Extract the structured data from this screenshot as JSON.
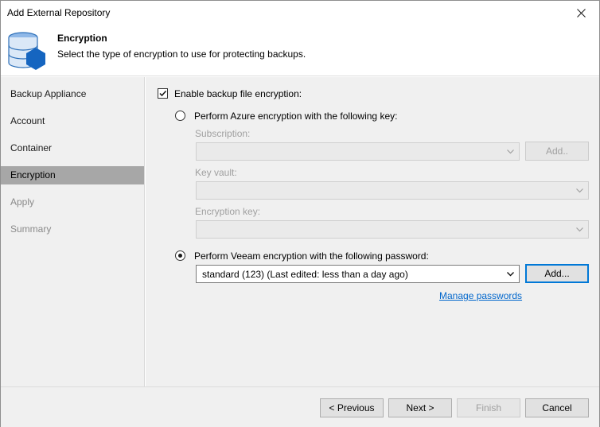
{
  "window": {
    "title": "Add External Repository"
  },
  "header": {
    "title": "Encryption",
    "subtitle": "Select the type of encryption to use for protecting backups.",
    "icon": "database-hexagon-icon"
  },
  "sidebar": {
    "items": [
      {
        "label": "Backup Appliance",
        "state": "normal"
      },
      {
        "label": "Account",
        "state": "normal"
      },
      {
        "label": "Container",
        "state": "normal"
      },
      {
        "label": "Encryption",
        "state": "active"
      },
      {
        "label": "Apply",
        "state": "disabled"
      },
      {
        "label": "Summary",
        "state": "disabled"
      }
    ]
  },
  "form": {
    "enable_label": "Enable backup file encryption:",
    "enable_checked": true,
    "azure": {
      "label": "Perform Azure encryption with the following key:",
      "selected": false,
      "subscription_label": "Subscription:",
      "subscription_value": "",
      "add_label": "Add..",
      "keyvault_label": "Key vault:",
      "keyvault_value": "",
      "enckey_label": "Encryption key:",
      "enckey_value": ""
    },
    "veeam": {
      "label": "Perform Veeam encryption with the following password:",
      "selected": true,
      "password_value": "standard (123) (Last edited: less than a day ago)",
      "add_label": "Add...",
      "manage_link": "Manage passwords"
    }
  },
  "footer": {
    "previous_label": "< Previous",
    "next_label": "Next >",
    "finish_label": "Finish",
    "cancel_label": "Cancel"
  },
  "colors": {
    "accent": "#0078d7",
    "link": "#0066cc",
    "icon_blue": "#1565c0",
    "active_item": "#a7a7a7"
  }
}
